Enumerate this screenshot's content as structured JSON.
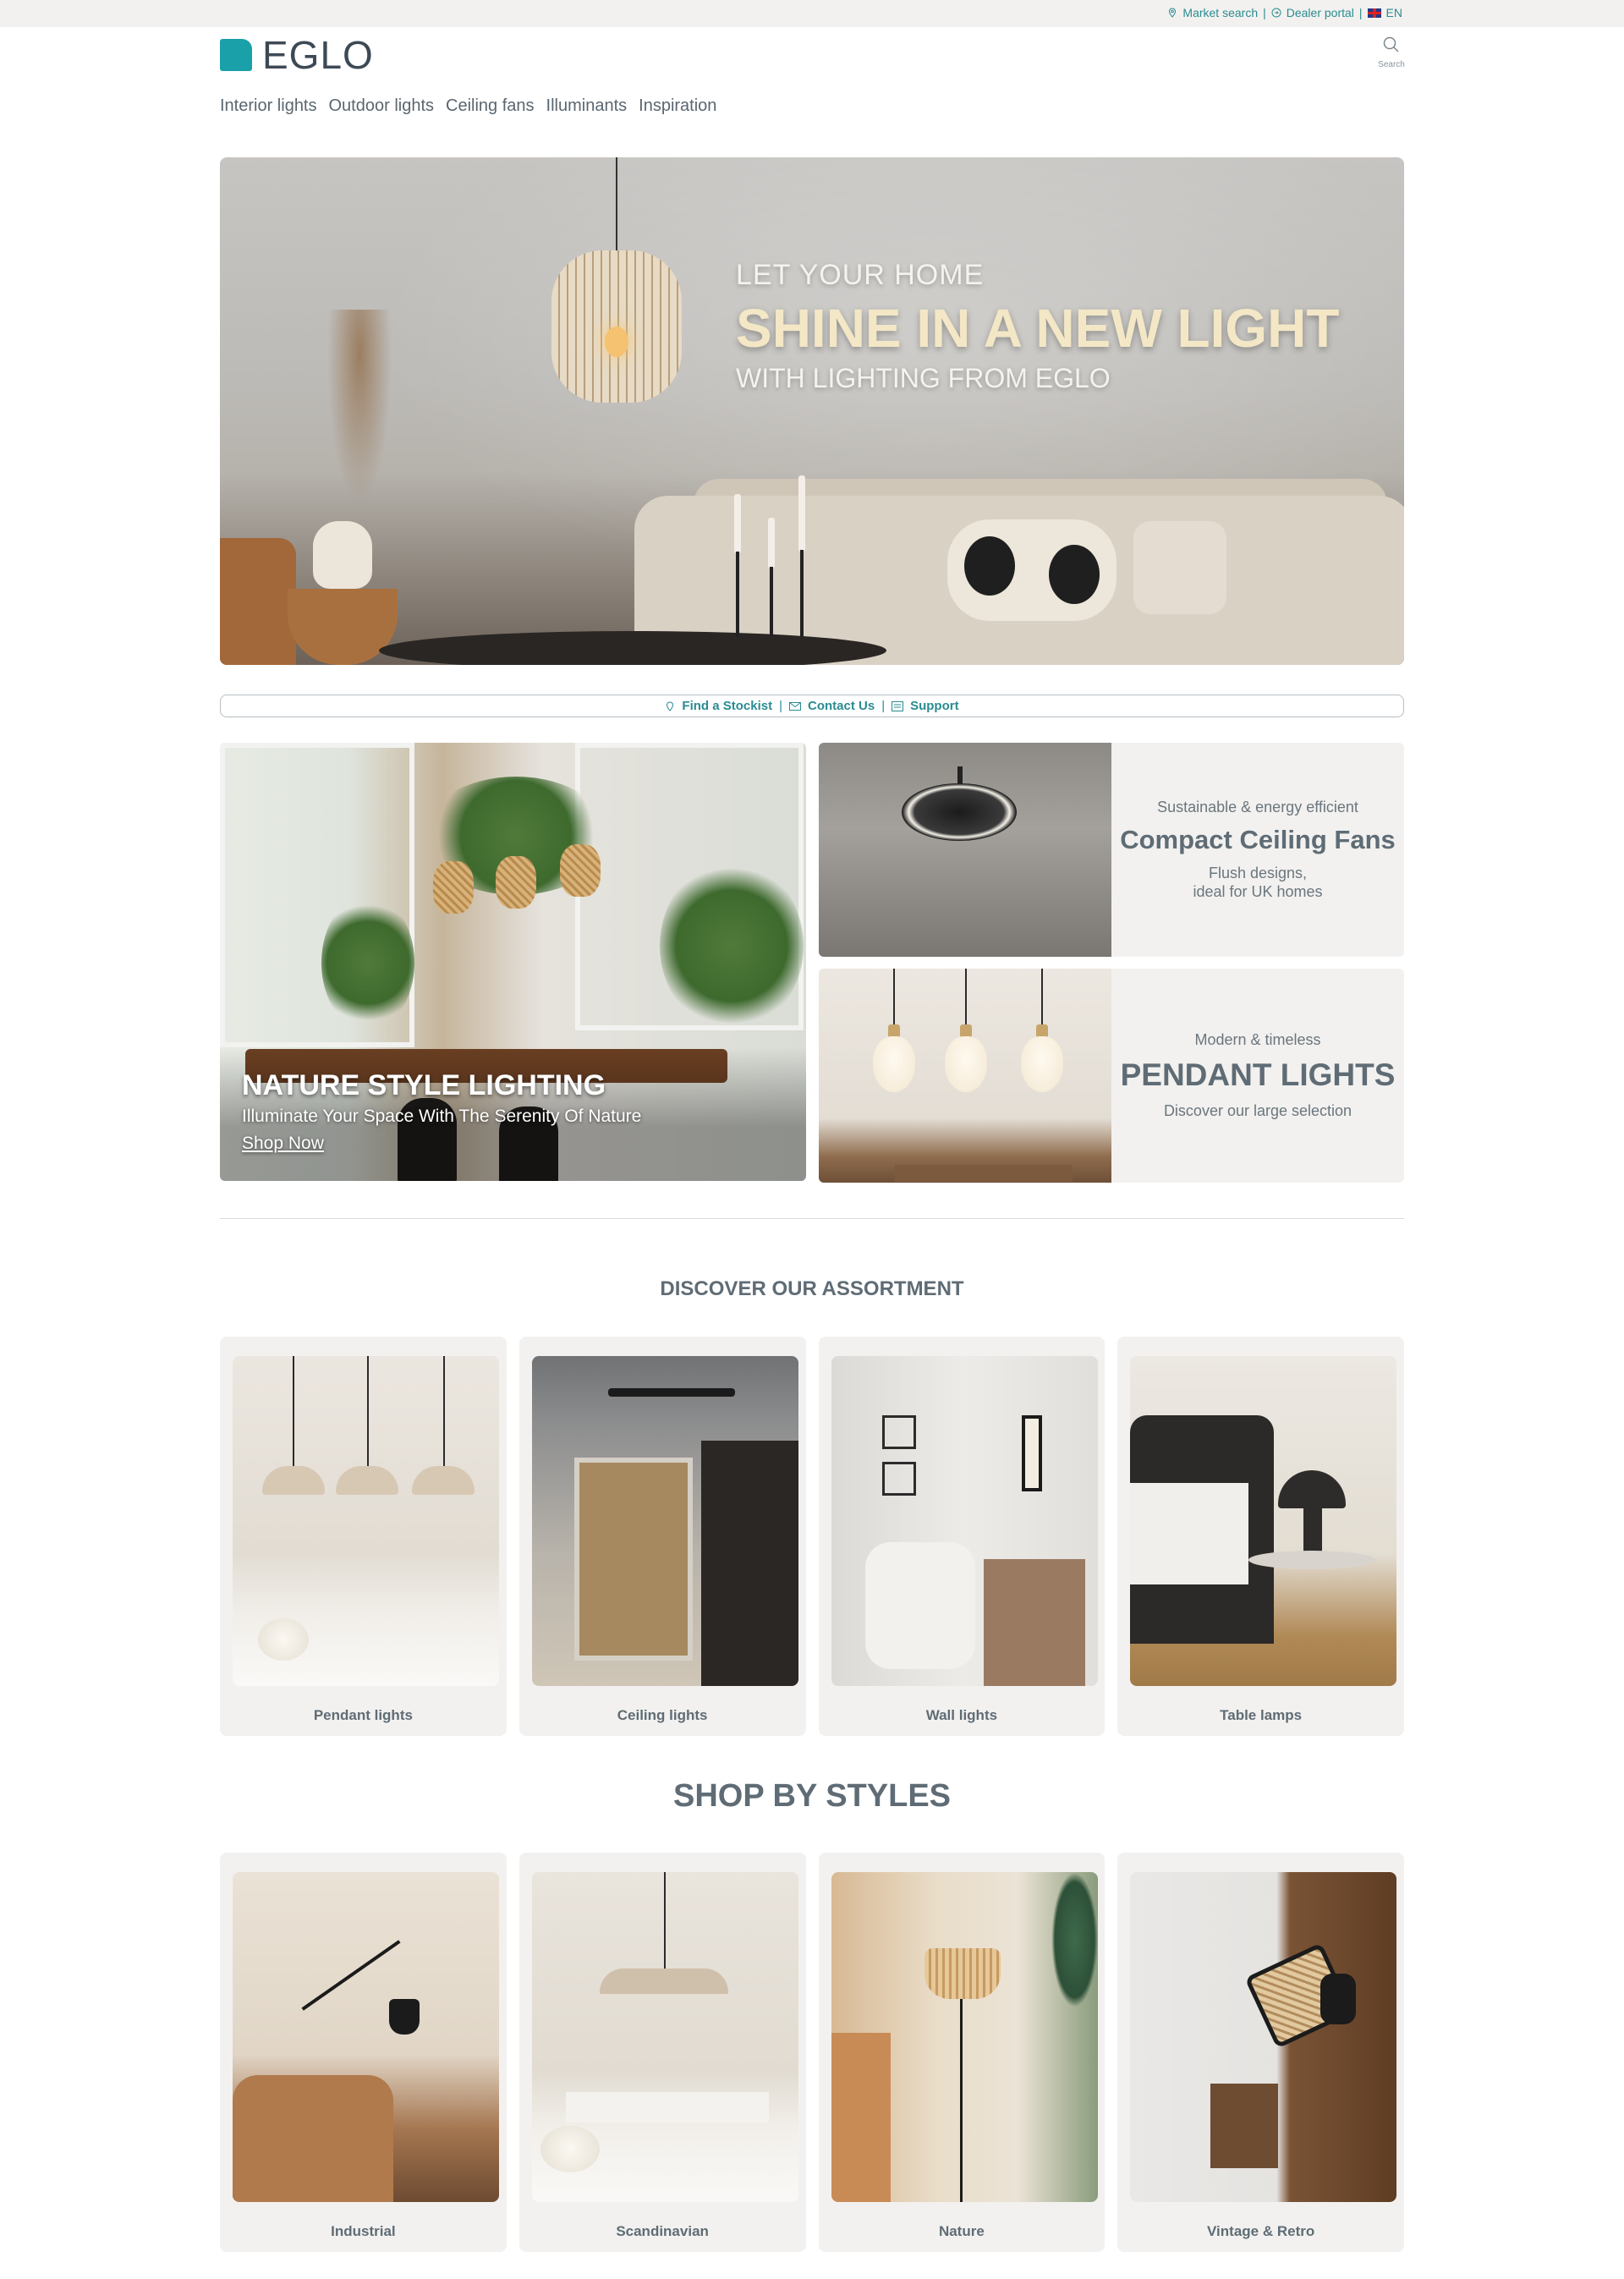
{
  "utility_bar": {
    "market_search": "Market search",
    "dealer_portal": "Dealer portal",
    "language": "EN",
    "separator": "|"
  },
  "header": {
    "logo_text": "EGLO",
    "search_label": "Search"
  },
  "nav": {
    "items": [
      "Interior lights",
      "Outdoor lights",
      "Ceiling fans",
      "Illuminants",
      "Inspiration"
    ]
  },
  "hero": {
    "line1": "LET YOUR HOME",
    "line2": "SHINE IN A NEW LIGHT",
    "line3": "WITH LIGHTING FROM EGLO"
  },
  "service_bar": {
    "stockist": "Find a Stockist",
    "contact": "Contact Us",
    "support": "Support",
    "separator": "|"
  },
  "promo": {
    "nature": {
      "title": "NATURE STYLE LIGHTING",
      "subtitle": "Illuminate Your Space With The Serenity Of Nature",
      "link": "Shop Now"
    },
    "fans": {
      "eyebrow": "Sustainable & energy efficient",
      "title": "Compact Ceiling Fans",
      "desc_line1": "Flush designs,",
      "desc_line2": "ideal for UK homes"
    },
    "pendants": {
      "eyebrow": "Modern & timeless",
      "title": "PENDANT LIGHTS",
      "desc": "Discover our large selection"
    }
  },
  "assortment": {
    "title": "DISCOVER OUR ASSORTMENT",
    "cards": [
      {
        "label": "Pendant lights"
      },
      {
        "label": "Ceiling lights"
      },
      {
        "label": "Wall lights"
      },
      {
        "label": "Table lamps"
      }
    ]
  },
  "styles": {
    "title": "SHOP BY STYLES",
    "cards": [
      {
        "label": "Industrial"
      },
      {
        "label": "Scandinavian"
      },
      {
        "label": "Nature"
      },
      {
        "label": "Vintage & Retro"
      }
    ]
  },
  "colors": {
    "accent": "#2a8c92",
    "logo": "#1aa0a8",
    "text": "#5f6c75",
    "card_bg": "#f2f1ef"
  },
  "icons": [
    "map-pin-icon",
    "portal-icon",
    "uk-flag-icon",
    "search-icon",
    "envelope-icon",
    "support-icon"
  ]
}
